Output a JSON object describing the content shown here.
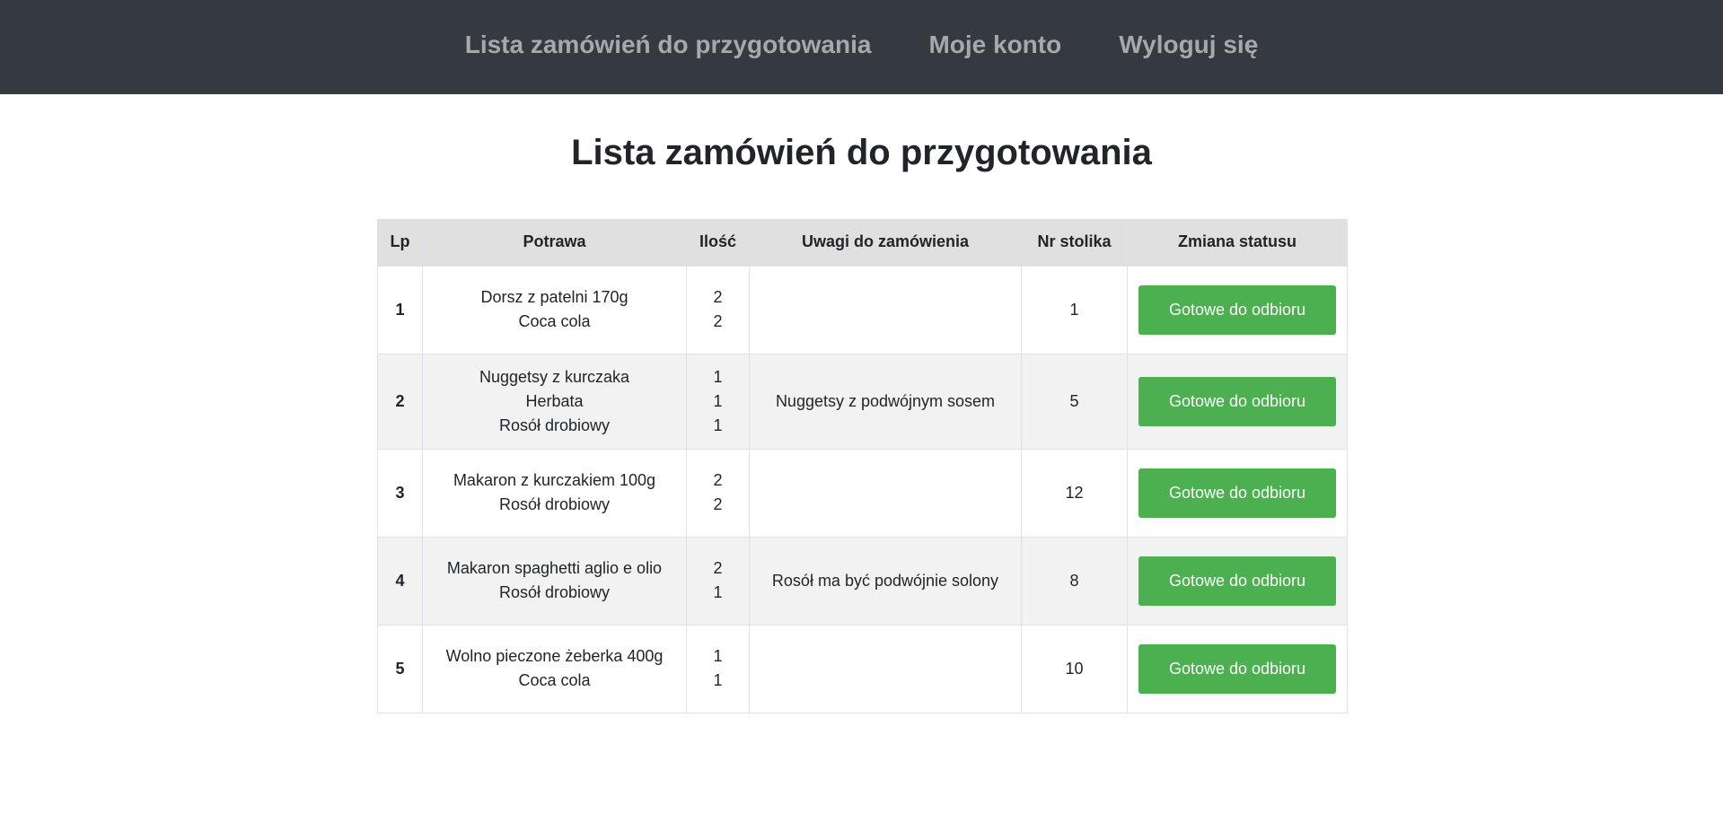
{
  "nav": {
    "items": [
      {
        "label": "Lista zamówień do przygotowania"
      },
      {
        "label": "Moje konto"
      },
      {
        "label": "Wyloguj się"
      }
    ]
  },
  "page": {
    "title": "Lista zamówień do przygotowania"
  },
  "table": {
    "headers": {
      "lp": "Lp",
      "dish": "Potrawa",
      "qty": "Ilość",
      "notes": "Uwagi do zamówienia",
      "table_no": "Nr stolika",
      "status": "Zmiana statusu"
    },
    "rows": [
      {
        "lp": "1",
        "dishes": [
          "Dorsz z patelni 170g",
          "Coca cola"
        ],
        "qtys": [
          "2",
          "2"
        ],
        "notes": "",
        "table_no": "1",
        "button": "Gotowe do odbioru"
      },
      {
        "lp": "2",
        "dishes": [
          "Nuggetsy z kurczaka",
          "Herbata",
          "Rosół drobiowy"
        ],
        "qtys": [
          "1",
          "1",
          "1"
        ],
        "notes": "Nuggetsy z podwójnym sosem",
        "table_no": "5",
        "button": "Gotowe do odbioru"
      },
      {
        "lp": "3",
        "dishes": [
          "Makaron z kurczakiem 100g",
          "Rosół drobiowy"
        ],
        "qtys": [
          "2",
          "2"
        ],
        "notes": "",
        "table_no": "12",
        "button": "Gotowe do odbioru"
      },
      {
        "lp": "4",
        "dishes": [
          "Makaron spaghetti aglio e olio",
          "Rosół drobiowy"
        ],
        "qtys": [
          "2",
          "1"
        ],
        "notes": "Rosół ma być podwójnie solony",
        "table_no": "8",
        "button": "Gotowe do odbioru"
      },
      {
        "lp": "5",
        "dishes": [
          "Wolno pieczone żeberka 400g",
          "Coca cola"
        ],
        "qtys": [
          "1",
          "1"
        ],
        "notes": "",
        "table_no": "10",
        "button": "Gotowe do odbioru"
      }
    ]
  },
  "colors": {
    "navbar_bg": "#343a40",
    "nav_link": "#a6a9ac",
    "header_row_bg": "#e0e0e0",
    "striped_row_bg": "#f2f2f2",
    "button_bg": "#4caf50",
    "button_text": "#ffffff"
  }
}
